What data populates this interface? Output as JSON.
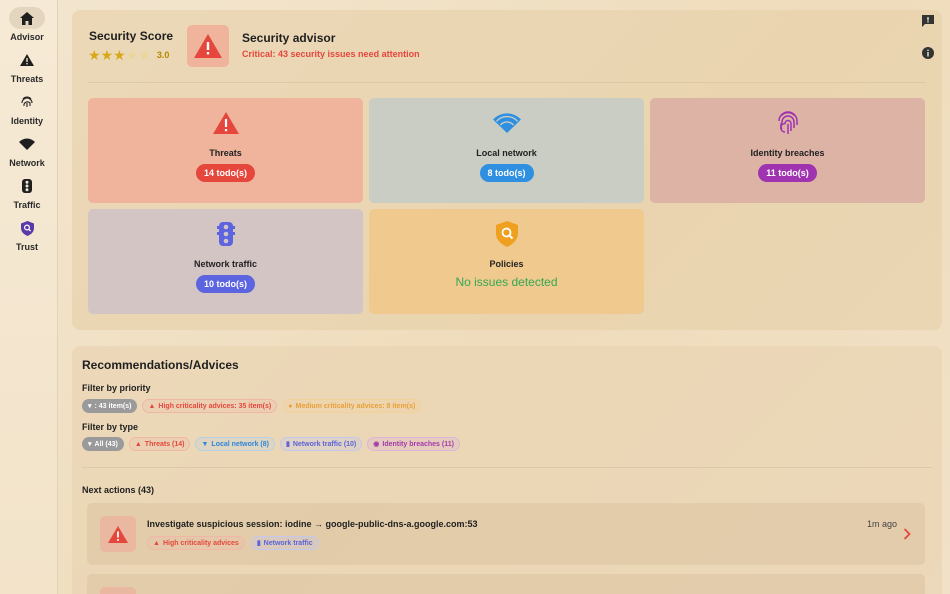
{
  "sidebar": {
    "items": [
      {
        "label": "Advisor",
        "icon": "home-icon",
        "active": true
      },
      {
        "label": "Threats",
        "icon": "warning-icon"
      },
      {
        "label": "Identity",
        "icon": "fingerprint-icon"
      },
      {
        "label": "Network",
        "icon": "wifi-icon"
      },
      {
        "label": "Traffic",
        "icon": "traffic-light-icon"
      },
      {
        "label": "Trust",
        "icon": "shield-search-icon"
      }
    ]
  },
  "header": {
    "score_title": "Security Score",
    "rating": 3.0,
    "rating_text": "3.0",
    "advisor_title": "Security advisor",
    "advisor_subtitle": "Critical: 43 security issues need attention"
  },
  "tiles": [
    {
      "name": "Threats",
      "pill": "14 todo(s)",
      "icon": "warning-icon",
      "bg": "#f0b49c",
      "pill_color": "#e5473c"
    },
    {
      "name": "Local network",
      "pill": "8 todo(s)",
      "icon": "wifi-icon",
      "bg": "#c9cdc4",
      "pill_color": "#2f8fe0"
    },
    {
      "name": "Identity breaches",
      "pill": "11 todo(s)",
      "icon": "fingerprint-icon",
      "bg": "#ddb3a6",
      "pill_color": "#a033b0"
    },
    {
      "name": "Network traffic",
      "pill": "10 todo(s)",
      "icon": "traffic-light-icon",
      "bg": "#d3c5c4",
      "pill_color": "#5c64e0"
    },
    {
      "name": "Policies",
      "ok": "No issues detected",
      "icon": "shield-search-icon",
      "bg": "#efc98e"
    }
  ],
  "recommendations": {
    "title": "Recommendations/Advices",
    "priority_label": "Filter by priority",
    "priority_chips": [
      {
        "text": ": 43 item(s)",
        "style": "sel",
        "icon": "filter-icon"
      },
      {
        "text": "High criticality advices: 35 item(s)",
        "style": "red",
        "icon": "warning-icon"
      },
      {
        "text": "Medium criticality advices: 8 item(s)",
        "style": "orange",
        "icon": "dot-icon"
      }
    ],
    "type_label": "Filter by type",
    "type_chips": [
      {
        "text": "All (43)",
        "style": "sel",
        "icon": "filter-icon"
      },
      {
        "text": "Threats (14)",
        "style": "red",
        "icon": "warning-icon"
      },
      {
        "text": "Local network (8)",
        "style": "blue",
        "icon": "wifi-icon"
      },
      {
        "text": "Network traffic (10)",
        "style": "indigo",
        "icon": "traffic-light-icon"
      },
      {
        "text": "Identity breaches (11)",
        "style": "purple",
        "icon": "fingerprint-icon"
      }
    ],
    "next_actions_label": "Next actions (43)",
    "actions": [
      {
        "title": "Investigate suspicious session: iodine → google-public-dns-a.google.com:53",
        "time": "1m ago",
        "chip_priority": "High criticality advices",
        "chip_type": "Network traffic"
      }
    ]
  },
  "colors": {
    "accent_red": "#e5473c",
    "accent_blue": "#2f8fe0",
    "accent_purple": "#a033b0",
    "accent_indigo": "#5c64e0",
    "accent_orange": "#e8a03a",
    "accent_green": "#34a853",
    "star_gold": "#d8a81a"
  }
}
